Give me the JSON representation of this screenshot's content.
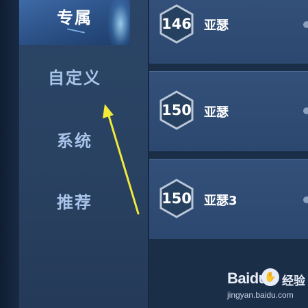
{
  "sidebar": {
    "active_tab": "专属",
    "tabs": [
      {
        "label": "自定义"
      },
      {
        "label": "系统"
      },
      {
        "label": "推荐"
      }
    ]
  },
  "cards": [
    {
      "level": "146",
      "name": "亚瑟"
    },
    {
      "level": "150",
      "name": "亚瑟"
    },
    {
      "level": "150",
      "name": "亚瑟3"
    }
  ],
  "annotation": {
    "arrow_color": "#f2e93a",
    "icon": "pointer-arrow-icon"
  },
  "watermark": {
    "logo": "Baidu",
    "paw_icon": "baidu-paw-icon",
    "text": "经验",
    "url": "jingyan.baidu.com"
  },
  "colors": {
    "card_bg": "#2e4a72",
    "sidebar_bg": "#2a4262",
    "active_tab": "#3e6aa6",
    "text_active": "#ffffff",
    "text_inactive": "#a9c4ea"
  }
}
